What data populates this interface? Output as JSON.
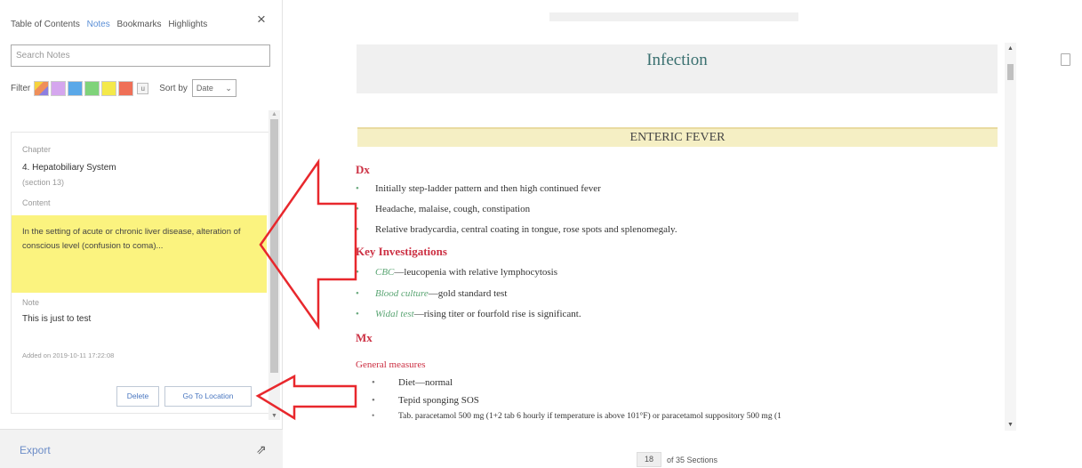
{
  "panel": {
    "tabs": [
      {
        "label": "Table of Contents",
        "active": false
      },
      {
        "label": "Notes",
        "active": true
      },
      {
        "label": "Bookmarks",
        "active": false
      },
      {
        "label": "Highlights",
        "active": false
      }
    ],
    "close_icon": "close-icon",
    "search_placeholder": "Search Notes",
    "filter_label": "Filter",
    "swatch_colors": [
      "#d5a6ee",
      "#5aa8e8",
      "#7fd37a",
      "#f4e94a",
      "#ef6f57"
    ],
    "sort_label": "Sort by",
    "sort_value": "Date",
    "note": {
      "chapter_label": "Chapter",
      "chapter_value": "4. Hepatobiliary System",
      "section_value": "(section 13)",
      "content_label": "Content",
      "content_text": "In the setting of acute or chronic liver disease, alteration of conscious level (confusion to coma)...",
      "note_label": "Note",
      "note_text": "This is just to test",
      "added_on": "Added on 2019-10-11 17:22:08",
      "delete_label": "Delete",
      "goto_label": "Go To Location",
      "highlight_color": "#fbf37f"
    },
    "export_label": "Export",
    "export_icon": "pin-icon"
  },
  "reader": {
    "page_title": "Infection",
    "section_title": "ENTERIC FEVER",
    "dx": {
      "heading": "Dx",
      "items": [
        "Initially step-ladder pattern and then high continued fever",
        "Headache, malaise, cough, constipation",
        "Relative bradycardia, central coating in tongue, rose spots and splenomegaly."
      ]
    },
    "investigations": {
      "heading": "Key Investigations",
      "items": [
        {
          "green": "CBC",
          "rest": "—leucopenia with relative lymphocytosis"
        },
        {
          "green": "Blood culture",
          "rest": "—gold standard test"
        },
        {
          "green": "Widal test",
          "rest": "—rising titer or fourfold rise is significant."
        }
      ]
    },
    "mx": {
      "heading": "Mx",
      "subheading": "General measures",
      "items": [
        "Diet—normal",
        "Tepid sponging SOS",
        "Tab. paracetamol 500 mg (1+2 tab 6 hourly if temperature is above 101°F) or paracetamol suppository 500 mg (1"
      ]
    },
    "page_number": "18",
    "page_total": "of 35 Sections",
    "bookmark_icon": "bookmark-icon"
  },
  "annotations": {
    "arrow_color": "#e8282d"
  }
}
